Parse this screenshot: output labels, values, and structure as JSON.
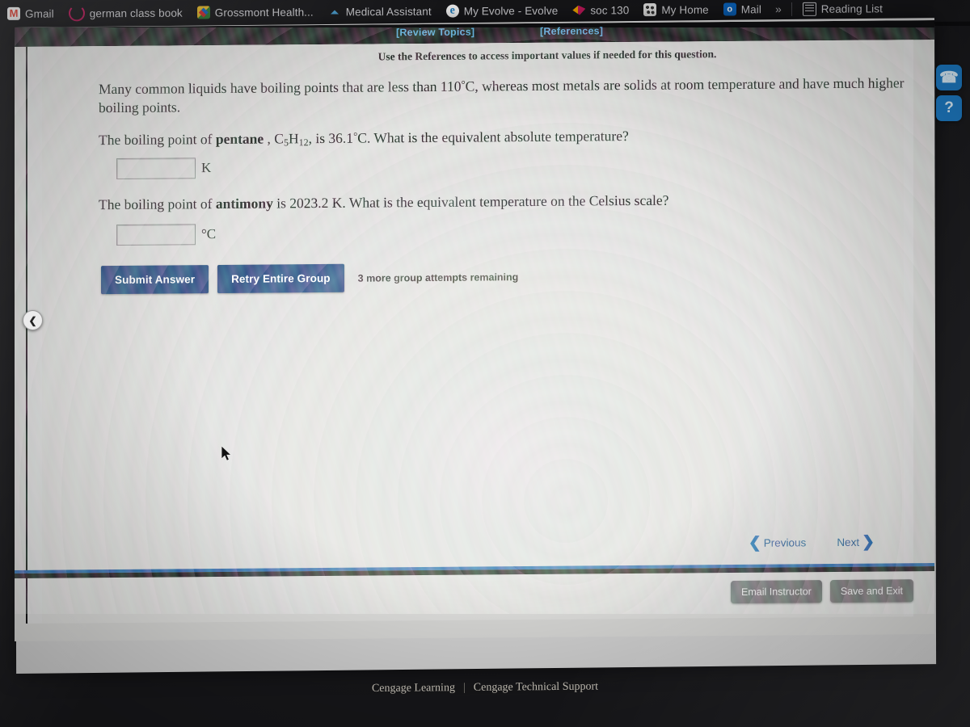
{
  "browser": {
    "bookmarks": [
      {
        "label": "Gmail",
        "icon": "gmail-icon"
      },
      {
        "label": "german class book",
        "icon": "loading-ring-icon"
      },
      {
        "label": "Grossmont Health...",
        "icon": "grossmont-icon"
      },
      {
        "label": "Medical Assistant",
        "icon": "caret-up-icon"
      },
      {
        "label": "My Evolve - Evolve",
        "icon": "evolve-icon"
      },
      {
        "label": "soc 130",
        "icon": "soc-icon"
      },
      {
        "label": "My Home",
        "icon": "myhome-icon"
      },
      {
        "label": "Mail",
        "icon": "outlook-mail-icon"
      }
    ],
    "overflow_label": "»",
    "reading_list_label": "Reading List"
  },
  "app_header": {
    "review_topics_label": "[Review Topics]",
    "references_label": "[References]",
    "link_color": "#5cb3e8"
  },
  "question": {
    "instruction": "Use the References to access important values if needed for this question.",
    "intro_part1": "Many common liquids have boiling points that are less than 110",
    "intro_deg": "°",
    "intro_part2": "C, whereas most metals are solids at room temperature and have much higher boiling points.",
    "q1_part1": "The boiling point of ",
    "q1_bold": "pentane",
    "q1_part2": " , C",
    "q1_sub1": "5",
    "q1_part3": "H",
    "q1_sub2": "12",
    "q1_part4": ", is 36.1",
    "q1_deg": "°",
    "q1_part5": "C. What is the equivalent absolute temperature?",
    "q1_unit": "K",
    "q1_value": "",
    "q2_part1": "The boiling point of ",
    "q2_bold": "antimony",
    "q2_part2": " is 2023.2 K. What is the equivalent temperature on the Celsius scale?",
    "q2_unit": "°C",
    "q2_value": ""
  },
  "actions": {
    "submit_label": "Submit Answer",
    "retry_label": "Retry Entire Group",
    "attempts_label": "3 more group attempts remaining",
    "button_color": "#1b3f78"
  },
  "navigation": {
    "previous_label": "Previous",
    "previous_chevron": "❮",
    "next_label": "Next",
    "next_chevron": "❯",
    "collapse_chevron": "❮"
  },
  "bottom_bar": {
    "email_instructor_label": "Email Instructor",
    "save_and_exit_label": "Save and Exit"
  },
  "helpers": {
    "support_glyph": "☎",
    "help_glyph": "?"
  },
  "footer": {
    "learning_label": "Cengage Learning",
    "separator": "|",
    "support_label": "Cengage Technical Support"
  }
}
